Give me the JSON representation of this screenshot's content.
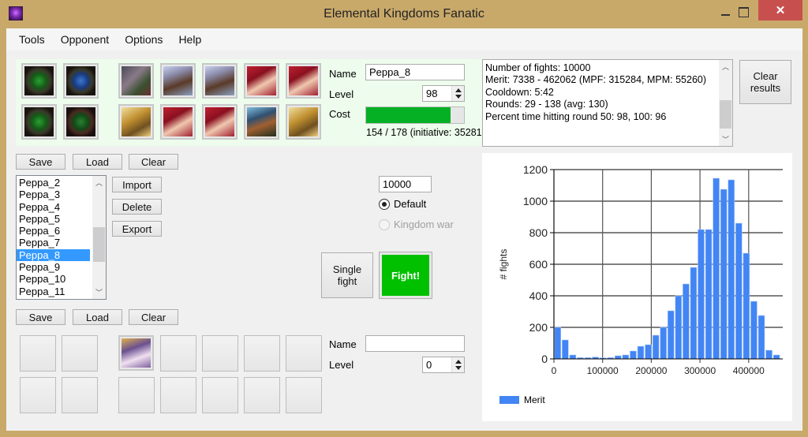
{
  "window": {
    "title": "Elemental Kingdoms Fanatic",
    "app_icon": "demon-face-icon",
    "controls": {
      "minimize": "minimize-icon",
      "maximize": "maximize-icon",
      "close": "close-icon",
      "close_glyph": "✕"
    }
  },
  "menu": [
    "Tools",
    "Opponent",
    "Options",
    "Help"
  ],
  "player_deck": {
    "runes": [
      {
        "name": "rune-green-1",
        "style": "rune"
      },
      {
        "name": "rune-blue",
        "style": "rune blue"
      },
      {
        "name": "rune-green-2",
        "style": "rune"
      },
      {
        "name": "rune-red-green",
        "style": "rune red"
      }
    ],
    "cards_row1": [
      {
        "name": "card-horned-elf",
        "style": "hero-a"
      },
      {
        "name": "card-dwarf-1",
        "style": "hero-b"
      },
      {
        "name": "card-dwarf-2",
        "style": "hero-b"
      },
      {
        "name": "card-red-elf-1",
        "style": "hero-c"
      },
      {
        "name": "card-red-elf-2",
        "style": "hero-c"
      }
    ],
    "cards_row2": [
      {
        "name": "card-golden-statue-1",
        "style": "hero-d"
      },
      {
        "name": "card-red-elf-3",
        "style": "hero-c"
      },
      {
        "name": "card-red-elf-4",
        "style": "hero-c"
      },
      {
        "name": "card-world-tree",
        "style": "hero-e"
      },
      {
        "name": "card-golden-statue-2",
        "style": "hero-d"
      }
    ],
    "name_label": "Name",
    "name_value": "Peppa_8",
    "level_label": "Level",
    "level_value": "98",
    "cost_label": "Cost",
    "cost_current": 154,
    "cost_max": 178,
    "cost_fraction": 0.865,
    "cost_text": "154 / 178 (initiative: 35281"
  },
  "deck_buttons": {
    "save": "Save",
    "load": "Load",
    "clear": "Clear"
  },
  "deck_list": {
    "items": [
      "Peppa_2",
      "Peppa_3",
      "Peppa_4",
      "Peppa_5",
      "Peppa_6",
      "Peppa_7",
      "Peppa_8",
      "Peppa_9",
      "Peppa_10",
      "Peppa_11"
    ],
    "selected": "Peppa_8",
    "import": "Import",
    "delete": "Delete",
    "export": "Export"
  },
  "simulation": {
    "fight_count": "10000",
    "mode_default": "Default",
    "mode_kingdom_war": "Kingdom war",
    "selected_mode": "Default",
    "single_fight": "Single fight",
    "fight": "Fight!"
  },
  "results": {
    "lines": [
      "Number of fights: 10000",
      "Merit: 7338 - 462062 (MPF: 315284, MPM: 55260)",
      "Cooldown: 5:42",
      "Rounds: 29 - 138 (avg: 130)",
      "Percent time hitting round 50: 98, 100: 96"
    ],
    "clear_label_1": "Clear",
    "clear_label_2": "results"
  },
  "opponent_buttons": {
    "save": "Save",
    "load": "Load",
    "clear": "Clear"
  },
  "opponent_deck": {
    "card": {
      "name": "card-winged-angel",
      "style": "hero-f"
    },
    "name_label": "Name",
    "name_value": "",
    "level_label": "Level",
    "level_value": "0"
  },
  "colors": {
    "accent_green": "#06b025",
    "fight_green": "#00c000",
    "bar_blue": "#4285f4",
    "selection_blue": "#3399ff",
    "close_red": "#c7504f"
  },
  "chart_data": {
    "type": "bar",
    "title": "",
    "xlabel": "",
    "ylabel": "# fights",
    "legend": [
      "Merit"
    ],
    "legend_position": "bottom-left",
    "grid": true,
    "xlim": [
      0,
      470000
    ],
    "ylim": [
      0,
      1200
    ],
    "xticks": [
      0,
      100000,
      200000,
      300000,
      400000
    ],
    "yticks": [
      0,
      200,
      400,
      600,
      800,
      1000,
      1200
    ],
    "bin_width": 15500,
    "x": [
      7750,
      23250,
      38750,
      54250,
      69750,
      85250,
      100750,
      116250,
      131750,
      147250,
      162750,
      178250,
      193750,
      209250,
      224750,
      240250,
      255750,
      271250,
      286750,
      302250,
      317750,
      333250,
      348750,
      364250,
      379750,
      395250,
      410750,
      426250,
      441750,
      457250
    ],
    "series": [
      {
        "name": "Merit",
        "color": "#4285f4",
        "values": [
          200,
          120,
          25,
          8,
          8,
          12,
          7,
          8,
          20,
          25,
          50,
          80,
          90,
          150,
          200,
          305,
          400,
          475,
          580,
          820,
          820,
          1145,
          1075,
          1135,
          860,
          670,
          365,
          275,
          55,
          25
        ]
      }
    ]
  }
}
